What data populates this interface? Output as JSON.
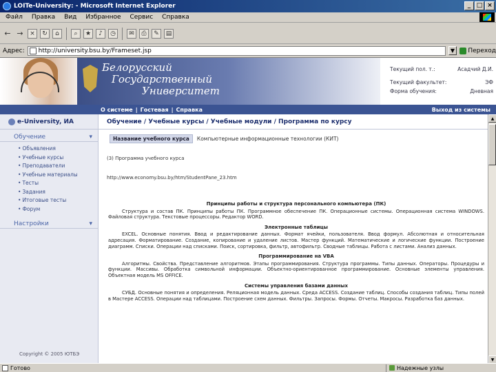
{
  "window": {
    "title": "LOITe-University: - Microsoft Internet Explorer"
  },
  "menu": [
    "Файл",
    "Правка",
    "Вид",
    "Избранное",
    "Сервис",
    "Справка"
  ],
  "address": {
    "label": "Адрес:",
    "url": "http://university.bsu.by/Frameset.jsp",
    "go_label": "Переход"
  },
  "site": {
    "university_line1": "Белорусский",
    "university_line2": "Государственный",
    "university_line3": "Университет",
    "user": {
      "current_user_label": "Текущий пол. т.:",
      "current_user_value": "Асадчий Д.И.",
      "faculty_label": "Текущий факультет:",
      "faculty_value": "ЭФ",
      "form_label": "Форма обучения:",
      "form_value": "Дневная"
    },
    "nav": {
      "links": [
        "О системе",
        "|",
        "Гостевая",
        "|",
        "Справка"
      ],
      "logout": "Выход из системы"
    }
  },
  "sidebar": {
    "brand": "e-University, ИА",
    "section1": "Обучение",
    "items": [
      "Объявления",
      "Учебные курсы",
      "Преподаватели",
      "Учебные материалы",
      "Тесты",
      "Задания",
      "Итоговые тесты",
      "Форум"
    ],
    "section2": "Настройки",
    "copyright": "Copyright © 2005 ЮТБЭ"
  },
  "content": {
    "breadcrumb": "Обучение / Учебные курсы / Учебные модули / Программа по курсу",
    "course_label": "Название учебного курса",
    "course_value": "Компьютерные информационные технологии (КИТ)",
    "program_link": "(3) Программа учебного курса",
    "resource_url": "http://www.economy.bsu.by/htm/StudentPane_23.htm",
    "sections": [
      {
        "heading": "Принципы работы и структура персонального компьютера (ПК)",
        "text": "Структура и состав ПК. Принципы работы ПК. Программное обеспечение ПК. Операционные системы. Операционная система WINDOWS. Файловая структура. Текстовые процессоры. Редактор WORD."
      },
      {
        "heading": "Электронные таблицы",
        "text": "EXCEL. Основные понятия. Ввод и редактирование данных. Формат ячейки, пользователя. Ввод формул. Абсолютная и относительная адресация. Форматирование. Создание, копирование и удаление листов. Мастер функций. Математические и логические функции. Построение диаграмм. Списки. Операции над списками. Поиск, сортировка, фильтр, автофильтр. Сводные таблицы. Работа с листами. Анализ данных."
      },
      {
        "heading": "Программирование на VBA",
        "text": "Алгоритмы. Свойства. Представление алгоритмов. Этапы программирования. Структура программы. Типы данных. Операторы. Процедуры и функции. Массивы. Обработка символьной информации. Объектно-ориентированное программирование. Основные элементы управления. Объектная модель MS OFFICE."
      },
      {
        "heading": "Системы управления базами данных",
        "text": "СУБД. Основные понятия и определения. Реляционная модель данных. Среда ACCESS. Создание таблиц. Способы создания таблиц. Типы полей в Мастере ACCESS. Операции над таблицами. Построение схем данных. Фильтры. Запросы. Формы. Отчеты. Макросы. Разработка баз данных."
      }
    ]
  },
  "status": {
    "left": "Готово",
    "zone": "Надежные узлы"
  }
}
